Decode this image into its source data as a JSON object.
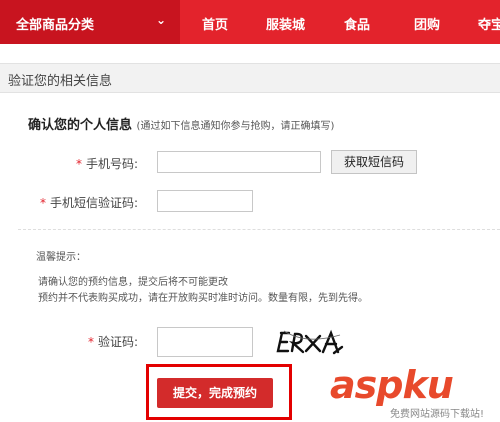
{
  "nav": {
    "category_label": "全部商品分类",
    "chevron": "chevron-down-icon",
    "items": [
      "首页",
      "服装城",
      "食品",
      "团购",
      "夺宝"
    ]
  },
  "section": {
    "title": "验证您的相关信息"
  },
  "form": {
    "confirm_title": "确认您的个人信息",
    "confirm_hint": "(通过如下信息通知你参与抢购，请正确填写)",
    "required_mark": "*",
    "phone_label": "手机号码:",
    "phone_value": "",
    "sms_button": "获取短信码",
    "sms_code_label": "手机短信验证码:",
    "sms_code_value": ""
  },
  "tips": {
    "title": "温馨提示：",
    "lines": [
      "请确认您的预约信息，提交后将不可能更改",
      "预约并不代表购买成功，请在开放购买时准时访问。数量有限，先到先得。"
    ]
  },
  "captcha": {
    "label": "验证码:",
    "value": "",
    "image_text": "ERXA"
  },
  "submit": {
    "label": "提交，完成预约"
  },
  "watermark": {
    "brand": "aspku",
    "sub": "免费网站源码下载站!"
  },
  "colors": {
    "nav_bg": "#e3232c",
    "category_bg": "#c8141f",
    "button_red": "#d32b2b",
    "highlight_border": "#e30000"
  }
}
